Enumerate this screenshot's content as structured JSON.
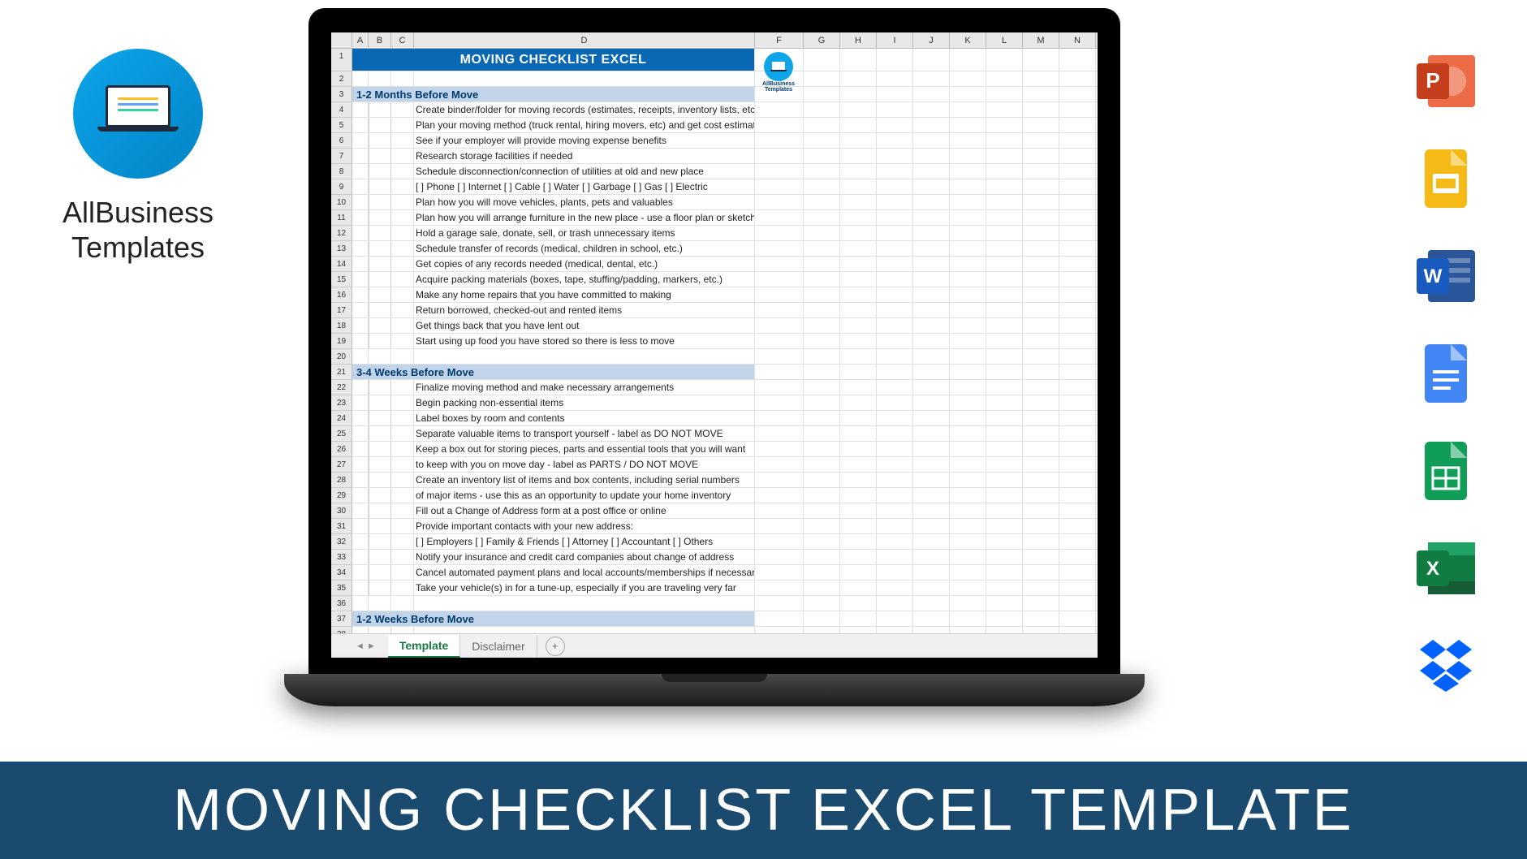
{
  "brand": {
    "line1": "AllBusiness",
    "line2": "Templates"
  },
  "spreadsheet": {
    "title": "MOVING CHECKLIST EXCEL",
    "logo_text": "AllBusiness Templates",
    "columns": [
      "A",
      "B",
      "C",
      "D",
      "F",
      "G",
      "H",
      "I",
      "J",
      "K",
      "L",
      "M",
      "N"
    ],
    "col_widths": {
      "A": 20,
      "B": 28,
      "C": 28,
      "D": 420,
      "F": 60,
      "G": 45,
      "H": 45,
      "I": 45,
      "J": 45,
      "K": 45,
      "L": 45,
      "M": 45,
      "N": 45
    },
    "sections": [
      {
        "row": 3,
        "title": "1-2 Months Before Move",
        "items": [
          "Create binder/folder for moving records (estimates, receipts, inventory lists, etc.)",
          "Plan your moving method (truck rental, hiring movers, etc) and get cost estimates",
          "See if your employer will provide moving expense benefits",
          "Research storage facilities if needed",
          "Schedule disconnection/connection of utilities at old and new place",
          "[  ] Phone   [  ] Internet   [  ] Cable   [  ] Water   [  ] Garbage   [  ] Gas   [  ] Electric",
          "Plan how you will move vehicles, plants, pets and valuables",
          "Plan how you will arrange furniture in the new place - use a floor plan or sketch",
          "Hold a garage sale, donate, sell, or trash unnecessary items",
          "Schedule transfer of records (medical, children in school, etc.)",
          "Get copies of any records needed (medical, dental, etc.)",
          "Acquire packing materials (boxes, tape, stuffing/padding, markers, etc.)",
          "Make any home repairs that you have committed to making",
          "Return borrowed, checked-out and rented items",
          "Get things back that you have lent out",
          "Start using up food you have stored so there is less to move"
        ]
      },
      {
        "row": 21,
        "title": "3-4 Weeks Before Move",
        "items": [
          "Finalize moving method and make necessary arrangements",
          "Begin packing non-essential items",
          "Label boxes by room and contents",
          "Separate valuable items to transport yourself - label as DO NOT MOVE",
          "Keep a box out for storing pieces, parts and essential tools that you will want",
          "to keep with you on move day - label as PARTS / DO NOT MOVE",
          "Create an inventory list of items and box contents, including serial numbers",
          "of major items - use this as an opportunity to update your home inventory",
          "Fill out a Change of Address  form at a post office or online",
          "Provide important contacts with your new address:",
          "[  ] Employers   [  ] Family & Friends   [  ] Attorney   [  ] Accountant   [  ] Others",
          "Notify your insurance and credit card companies about change of address",
          "Cancel automated payment plans and local accounts/memberships if necessary",
          "Take your vehicle(s) in for a tune-up, especially if you are traveling very far"
        ]
      },
      {
        "row": 37,
        "title": "1-2 Weeks Before Move",
        "items": []
      }
    ],
    "tabs": {
      "active": "Template",
      "others": [
        "Disclaimer"
      ]
    }
  },
  "banner": "MOVING CHECKLIST EXCEL TEMPLATE",
  "app_icons": [
    "powerpoint",
    "google-slides",
    "word",
    "google-docs",
    "google-sheets",
    "excel",
    "dropbox"
  ]
}
